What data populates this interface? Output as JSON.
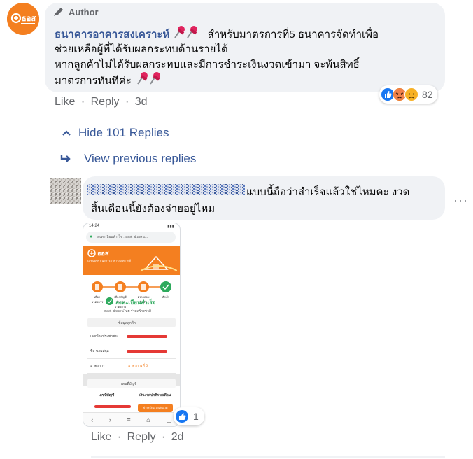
{
  "comment": {
    "author_badge": "Author",
    "page_name": "ธนาคารอาคารสงเคราะห์",
    "page_logo_text": "ธอส",
    "line1": "สำหรับมาตรการที่5 ธนาคารจัดทำเพื่อ",
    "line2": "ช่วยเหลือผู้ที่ได้รับผลกระทบด้านรายได้",
    "line3": "หากลูกค้าไม่ได้รับผลกระทบและมีการชำระเงินงวดเข้ามา จะพ้นสิทธิ์",
    "line4": "มาตรการทันทีค่ะ",
    "reaction_count": "82",
    "reaction_icons": [
      "like-icon",
      "angry-icon",
      "sad-icon"
    ],
    "actions": {
      "like": "Like",
      "reply": "Reply",
      "time": "3d",
      "separator": "·"
    }
  },
  "replies_toggle": {
    "hide_label": "Hide 101 Replies",
    "view_previous_label": "View previous replies"
  },
  "reply": {
    "line1": "แบบนี้ถือว่าสำเร็จแล้วใช่ไหมคะ งวด",
    "line2": "สิ้นเดือนนี้ยังต้องจ่ายอยู่ไหม",
    "more_label": "···",
    "like_count": "1",
    "actions": {
      "like": "Like",
      "reply": "Reply",
      "time": "2d",
      "separator": "·"
    },
    "attachment": {
      "status_time": "14:24",
      "url_text": "ลงทะเบียนสำเร็จ : ธอส. ช่วยคน...",
      "logo_text": "ธอส",
      "logo_sub": "GHBANK ธนาคารอาคารสงเคราะห์",
      "steps": [
        "เลือกมาตรการ",
        "เลือกบัญชี สำหรับมาตรการ",
        "ตรวจสอบ ยืนยัน",
        "สำเร็จ"
      ],
      "success_title": "ลงทะเบียนสำเร็จ",
      "success_sub": "ธอส. ช่วยคนไทย ร่วมสร้างชาติ",
      "section_customer": "ข้อมูลลูกค้า",
      "row_id": "เลขบัตรประชาชน",
      "row_name": "ชื่อ-นามสกุล",
      "row_measure": "มาตรการ",
      "row_measure_value": "มาตรการที่ 5",
      "section_account": "เลขที่บัญชี",
      "account_label": "เลขที่บัญชี",
      "amount_label": "เงินงวดปกติรายเดือน",
      "button_label": "ชำระเงินงวดเงินงวด"
    }
  },
  "colors": {
    "link_blue": "#385898",
    "meta_gray": "#65676b",
    "bubble_bg": "#f0f2f5",
    "ghb_orange": "#f47f20",
    "like_blue": "#1877f2",
    "success_green": "#2eaa5d"
  }
}
